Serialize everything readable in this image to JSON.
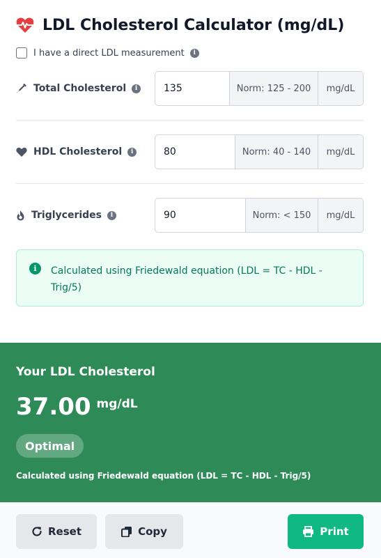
{
  "title": "LDL Cholesterol Calculator (mg/dL)",
  "direct": {
    "label": "I have a direct LDL measurement",
    "checked": false
  },
  "fields": [
    {
      "label": "Total Cholesterol",
      "icon": "syringe-icon",
      "value": "135",
      "norm": "Norm: 125 - 200",
      "unit": "mg/dL"
    },
    {
      "label": "HDL Cholesterol",
      "icon": "heart-icon",
      "value": "80",
      "norm": "Norm: 40 - 140",
      "unit": "mg/dL"
    },
    {
      "label": "Triglycerides",
      "icon": "fire-icon",
      "value": "90",
      "norm": "Norm: < 150",
      "unit": "mg/dL"
    }
  ],
  "note": "Calculated using Friedewald equation (LDL = TC - HDL - Trig/5)",
  "result": {
    "heading": "Your LDL Cholesterol",
    "value": "37.00",
    "unit": "mg/dL",
    "status": "Optimal",
    "method": "Calculated using Friedewald equation (LDL = TC - HDL - Trig/5)"
  },
  "buttons": {
    "reset": "Reset",
    "copy": "Copy",
    "print": "Print"
  },
  "colors": {
    "accent": "#2e8b57",
    "heart": "#e53e3e",
    "print": "#10b981",
    "note_bg": "#ecfdf5"
  }
}
